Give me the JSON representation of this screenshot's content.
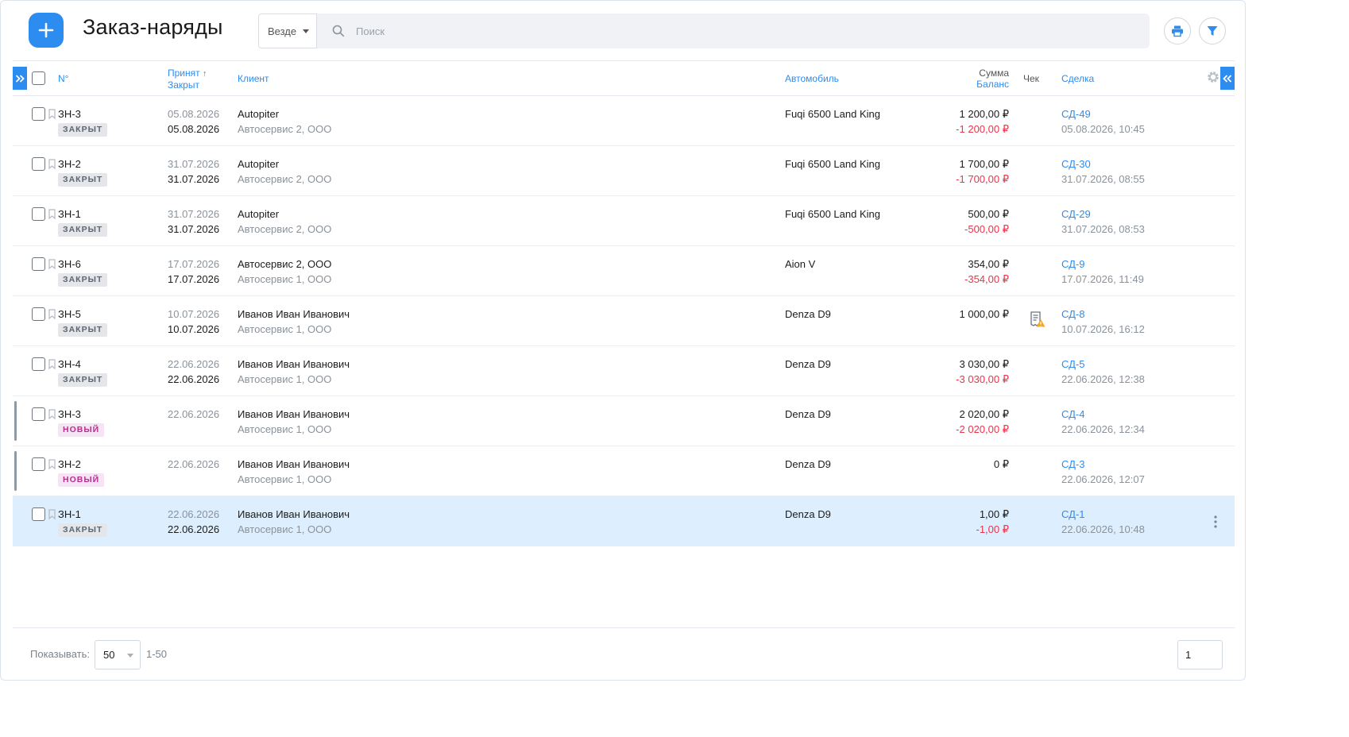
{
  "header": {
    "title": "Заказ-наряды",
    "scope": "Везде",
    "search_placeholder": "Поиск"
  },
  "columns": {
    "number": "N°",
    "accepted": "Принят",
    "accepted_sort_arrow": "↑",
    "closed": "Закрыт",
    "client": "Клиент",
    "car": "Автомобиль",
    "sum": "Сумма",
    "balance": "Баланс",
    "check": "Чек",
    "deal": "Сделка"
  },
  "rows": [
    {
      "number": "ЗН-3",
      "status": "ЗАКРЫТ",
      "status_type": "closed",
      "accepted": "05.08.2026",
      "closed": "05.08.2026",
      "client": "Autopiter",
      "org": "Автосервис 2, ООО",
      "car": "Fuqi 6500 Land King",
      "sum": "1 200,00 ₽",
      "balance": "-1 200,00 ₽",
      "receipt_warning": false,
      "deal": "СД-49",
      "deal_date": "05.08.2026, 10:45",
      "marked": false,
      "selected": false
    },
    {
      "number": "ЗН-2",
      "status": "ЗАКРЫТ",
      "status_type": "closed",
      "accepted": "31.07.2026",
      "closed": "31.07.2026",
      "client": "Autopiter",
      "org": "Автосервис 2, ООО",
      "car": "Fuqi 6500 Land King",
      "sum": "1 700,00 ₽",
      "balance": "-1 700,00 ₽",
      "receipt_warning": false,
      "deal": "СД-30",
      "deal_date": "31.07.2026, 08:55",
      "marked": false,
      "selected": false
    },
    {
      "number": "ЗН-1",
      "status": "ЗАКРЫТ",
      "status_type": "closed",
      "accepted": "31.07.2026",
      "closed": "31.07.2026",
      "client": "Autopiter",
      "org": "Автосервис 2, ООО",
      "car": "Fuqi 6500 Land King",
      "sum": "500,00 ₽",
      "balance": "-500,00 ₽",
      "receipt_warning": false,
      "deal": "СД-29",
      "deal_date": "31.07.2026, 08:53",
      "marked": false,
      "selected": false
    },
    {
      "number": "ЗН-6",
      "status": "ЗАКРЫТ",
      "status_type": "closed",
      "accepted": "17.07.2026",
      "closed": "17.07.2026",
      "client": "Автосервис 2, ООО",
      "org": "Автосервис 1, ООО",
      "car": "Aion V",
      "sum": "354,00 ₽",
      "balance": "-354,00 ₽",
      "receipt_warning": false,
      "deal": "СД-9",
      "deal_date": "17.07.2026, 11:49",
      "marked": false,
      "selected": false
    },
    {
      "number": "ЗН-5",
      "status": "ЗАКРЫТ",
      "status_type": "closed",
      "accepted": "10.07.2026",
      "closed": "10.07.2026",
      "client": "Иванов Иван Иванович",
      "org": "Автосервис 1, ООО",
      "car": "Denza D9",
      "sum": "1 000,00 ₽",
      "balance": "",
      "receipt_warning": true,
      "deal": "СД-8",
      "deal_date": "10.07.2026, 16:12",
      "marked": false,
      "selected": false
    },
    {
      "number": "ЗН-4",
      "status": "ЗАКРЫТ",
      "status_type": "closed",
      "accepted": "22.06.2026",
      "closed": "22.06.2026",
      "client": "Иванов Иван Иванович",
      "org": "Автосервис 1, ООО",
      "car": "Denza D9",
      "sum": "3 030,00 ₽",
      "balance": "-3 030,00 ₽",
      "receipt_warning": false,
      "deal": "СД-5",
      "deal_date": "22.06.2026, 12:38",
      "marked": false,
      "selected": false
    },
    {
      "number": "ЗН-3",
      "status": "НОВЫЙ",
      "status_type": "new",
      "accepted": "22.06.2026",
      "closed": "",
      "client": "Иванов Иван Иванович",
      "org": "Автосервис 1, ООО",
      "car": "Denza D9",
      "sum": "2 020,00 ₽",
      "balance": "-2 020,00 ₽",
      "receipt_warning": false,
      "deal": "СД-4",
      "deal_date": "22.06.2026, 12:34",
      "marked": true,
      "selected": false
    },
    {
      "number": "ЗН-2",
      "status": "НОВЫЙ",
      "status_type": "new",
      "accepted": "22.06.2026",
      "closed": "",
      "client": "Иванов Иван Иванович",
      "org": "Автосервис 1, ООО",
      "car": "Denza D9",
      "sum": "0 ₽",
      "balance": "",
      "receipt_warning": false,
      "deal": "СД-3",
      "deal_date": "22.06.2026, 12:07",
      "marked": true,
      "selected": false
    },
    {
      "number": "ЗН-1",
      "status": "ЗАКРЫТ",
      "status_type": "closed",
      "accepted": "22.06.2026",
      "closed": "22.06.2026",
      "client": "Иванов Иван Иванович",
      "org": "Автосервис 1, ООО",
      "car": "Denza D9",
      "sum": "1,00 ₽",
      "balance": "-1,00 ₽",
      "receipt_warning": false,
      "deal": "СД-1",
      "deal_date": "22.06.2026, 10:48",
      "marked": false,
      "selected": true
    }
  ],
  "footer": {
    "show_label": "Показывать:",
    "per_page": "50",
    "range": "1-50",
    "page": "1"
  },
  "colors": {
    "accent": "#2d8cf0",
    "negative": "#e8364b",
    "selected_row": "#ddeefe",
    "badge_closed_bg": "#e4e6ea",
    "badge_new_bg": "#f6e4f4",
    "badge_new_text": "#b8308f",
    "warning": "#f5a623"
  },
  "icons": {
    "add": "plus-icon",
    "search": "search-icon",
    "print": "printer-icon",
    "filter": "filter-icon",
    "settings": "gear-icon",
    "expand_left": "double-chevron-right-icon",
    "expand_right": "double-chevron-left-icon",
    "row_mark": "bookmark-icon",
    "receipt": "receipt-warning-icon",
    "row_menu": "kebab-menu-icon"
  }
}
